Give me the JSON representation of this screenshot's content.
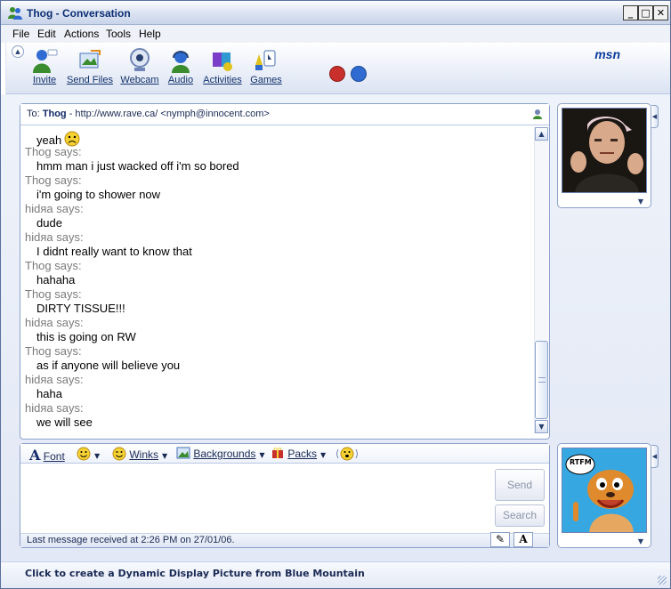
{
  "window": {
    "title": "Thog - Conversation",
    "controls": [
      "_",
      "□",
      "✕"
    ]
  },
  "menu": [
    "File",
    "Edit",
    "Actions",
    "Tools",
    "Help"
  ],
  "toolbar": {
    "buttons": [
      {
        "label": "Invite",
        "icon": "invite-icon"
      },
      {
        "label": "Send Files",
        "icon": "send-files-icon"
      },
      {
        "label": "Webcam",
        "icon": "webcam-icon"
      },
      {
        "label": "Audio",
        "icon": "audio-icon"
      },
      {
        "label": "Activities",
        "icon": "activities-icon"
      },
      {
        "label": "Games",
        "icon": "games-icon"
      }
    ],
    "logo": "msn"
  },
  "to_bar": {
    "prefix": "To:",
    "name": "Thog",
    "rest": " - http://www.rave.ca/  <nymph@innocent.com>"
  },
  "messages": [
    {
      "type": "text",
      "text": "yeah",
      "emoticon": "sad-emoticon-icon"
    },
    {
      "type": "name",
      "text": "Thog says:"
    },
    {
      "type": "text",
      "text": "hmm man i just wacked off i'm so bored"
    },
    {
      "type": "name",
      "text": "Thog says:"
    },
    {
      "type": "text",
      "text": "i'm going to shower now"
    },
    {
      "type": "name",
      "text": "hidяa says:"
    },
    {
      "type": "text",
      "text": "dude"
    },
    {
      "type": "name",
      "text": "hidяa says:"
    },
    {
      "type": "text",
      "text": "I didnt really want to know that"
    },
    {
      "type": "name",
      "text": "Thog says:"
    },
    {
      "type": "text",
      "text": "hahaha"
    },
    {
      "type": "name",
      "text": "Thog says:"
    },
    {
      "type": "text",
      "text": "DIRTY TISSUE!!!"
    },
    {
      "type": "name",
      "text": "hidяa says:"
    },
    {
      "type": "text",
      "text": "this is going on RW"
    },
    {
      "type": "name",
      "text": "Thog says:"
    },
    {
      "type": "text",
      "text": "as if anyone will believe you"
    },
    {
      "type": "name",
      "text": "hidяa says:"
    },
    {
      "type": "text",
      "text": "haha"
    },
    {
      "type": "name",
      "text": "hidяa says:"
    },
    {
      "type": "text",
      "text": "we will see"
    }
  ],
  "format_bar": {
    "font_label": "Font",
    "winks_label": "Winks",
    "backgrounds_label": "Backgrounds",
    "packs_label": "Packs"
  },
  "compose": {
    "send_label": "Send",
    "search_label": "Search",
    "status": "Last message received at 2:26 PM on 27/01/06."
  },
  "display_pictures": {
    "bottom_caption": "RTFM"
  },
  "bottom_bar": {
    "link": "Click to create a Dynamic Display Picture from Blue Mountain"
  },
  "colors": {
    "accent": "#0b2d73",
    "name_gray": "#7a7a7a",
    "border": "#8da2cb"
  }
}
